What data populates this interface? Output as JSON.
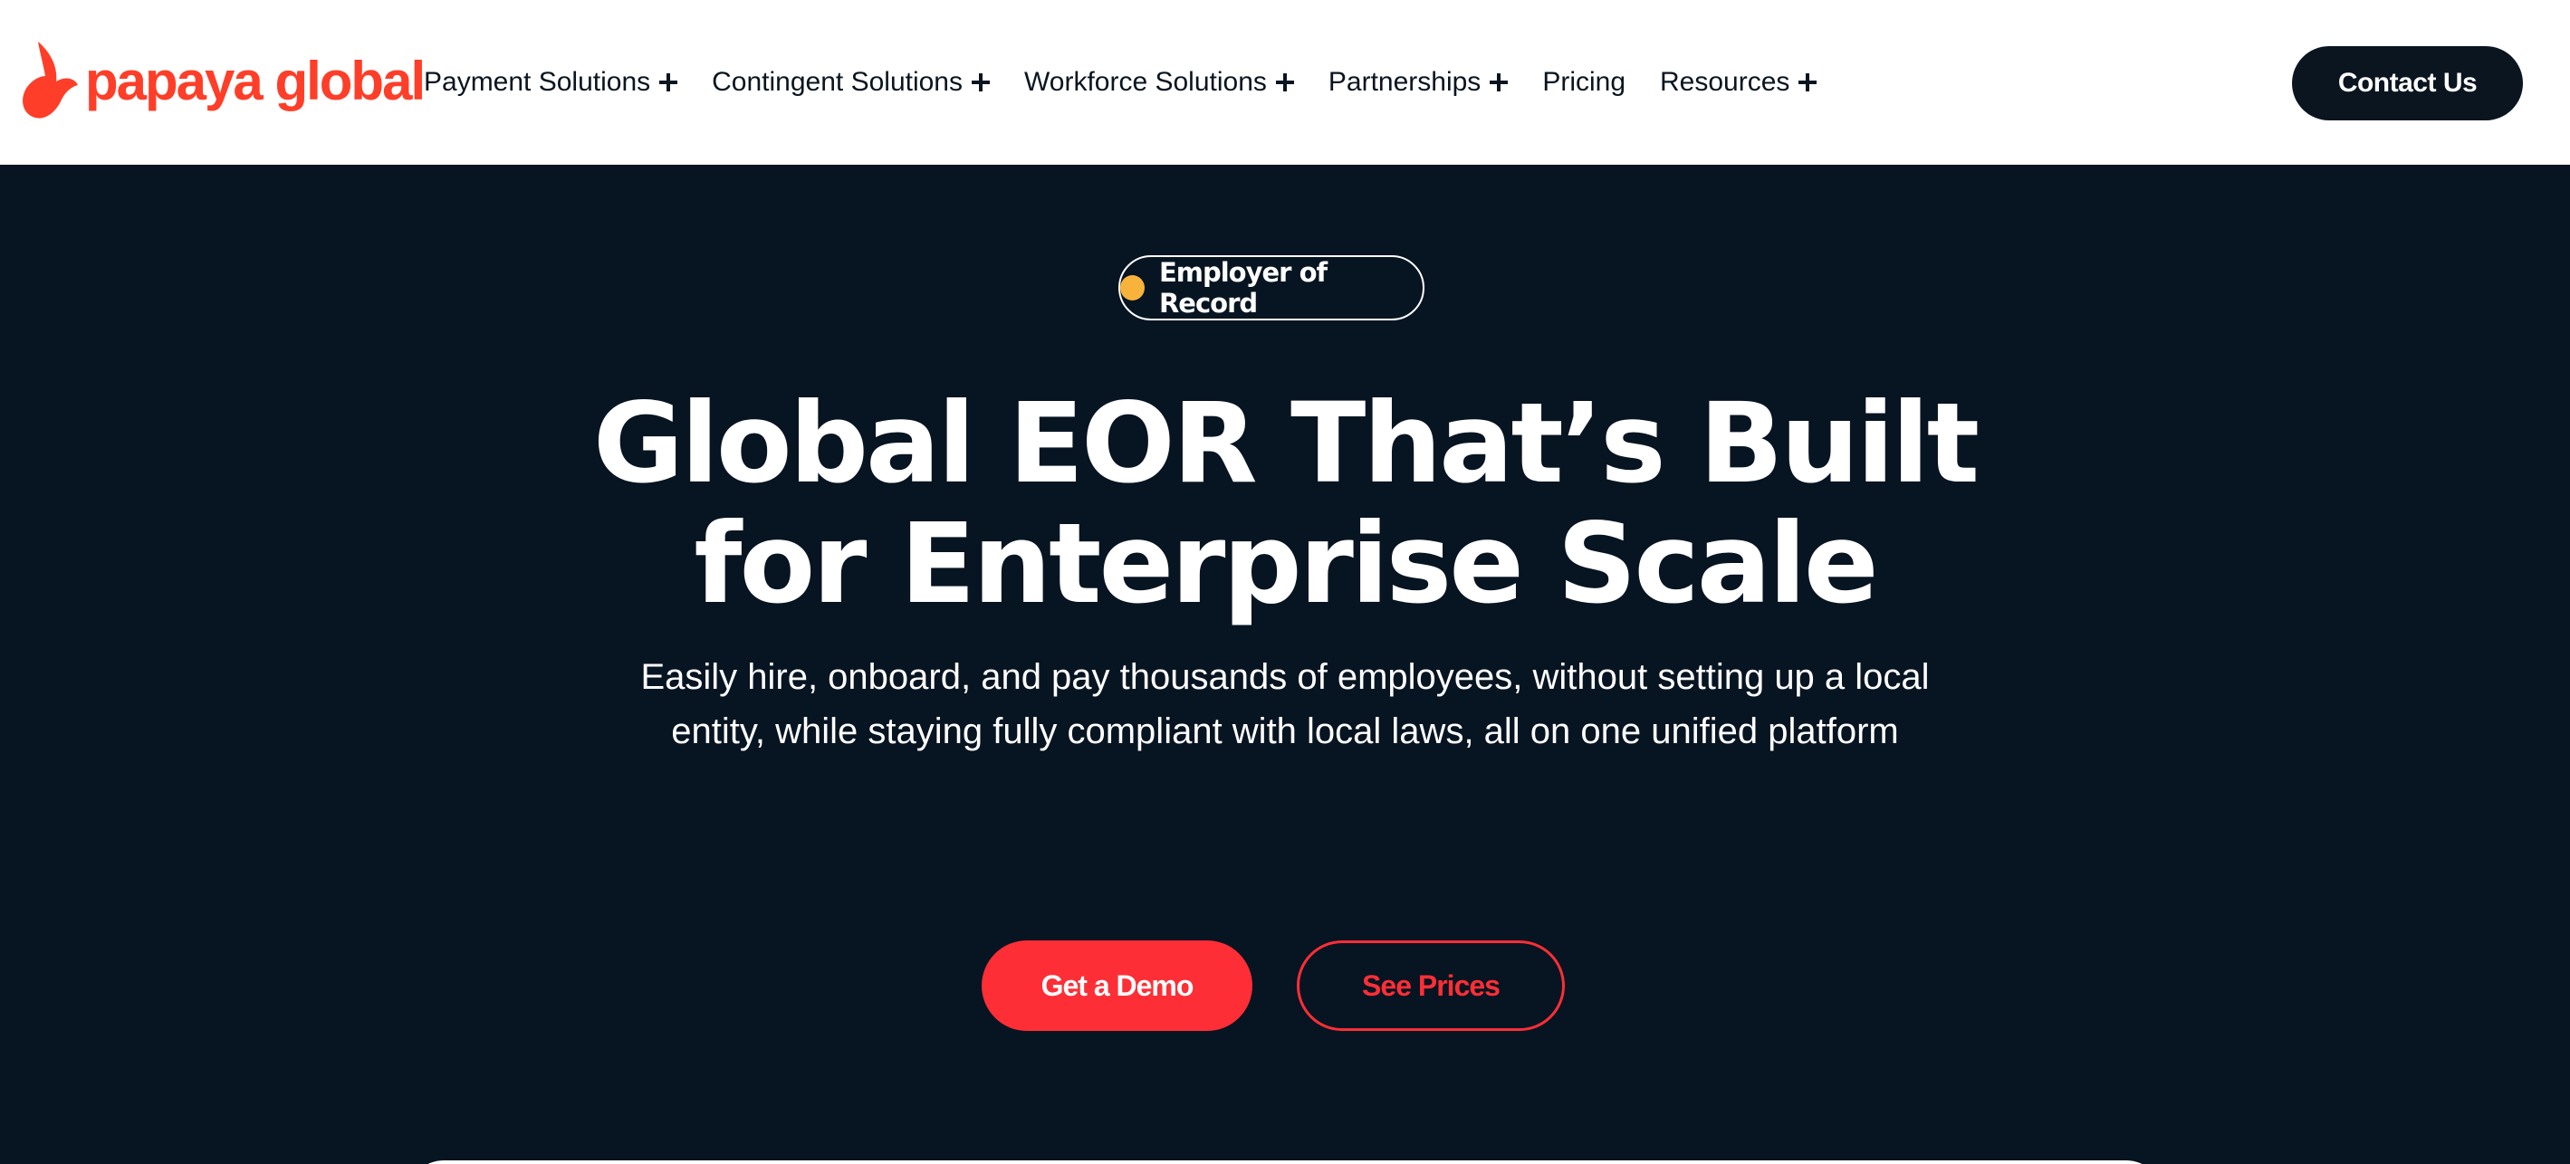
{
  "brand": {
    "name": "papaya global",
    "color": "#fe3e28"
  },
  "nav": {
    "items": [
      {
        "label": "Payment Solutions",
        "has_submenu": true
      },
      {
        "label": "Contingent Solutions",
        "has_submenu": true
      },
      {
        "label": "Workforce Solutions",
        "has_submenu": true
      },
      {
        "label": "Partnerships",
        "has_submenu": true
      },
      {
        "label": "Pricing",
        "has_submenu": false
      },
      {
        "label": "Resources",
        "has_submenu": true
      }
    ],
    "submenu_icon": "plus-icon",
    "contact_label": "Contact Us"
  },
  "hero": {
    "badge_label": "Employer of Record",
    "badge_dot_color": "#f7b33b",
    "headline_line1": "Global EOR That’s Built",
    "headline_line2": "for Enterprise Scale",
    "subtitle": "Easily hire, onboard, and pay thousands of employees, without setting up a local entity, while staying fully compliant with local laws, all on one unified platform",
    "primary_cta": "Get a Demo",
    "secondary_cta": "See Prices",
    "background_color": "#071421",
    "accent_color": "#fe2e36"
  }
}
